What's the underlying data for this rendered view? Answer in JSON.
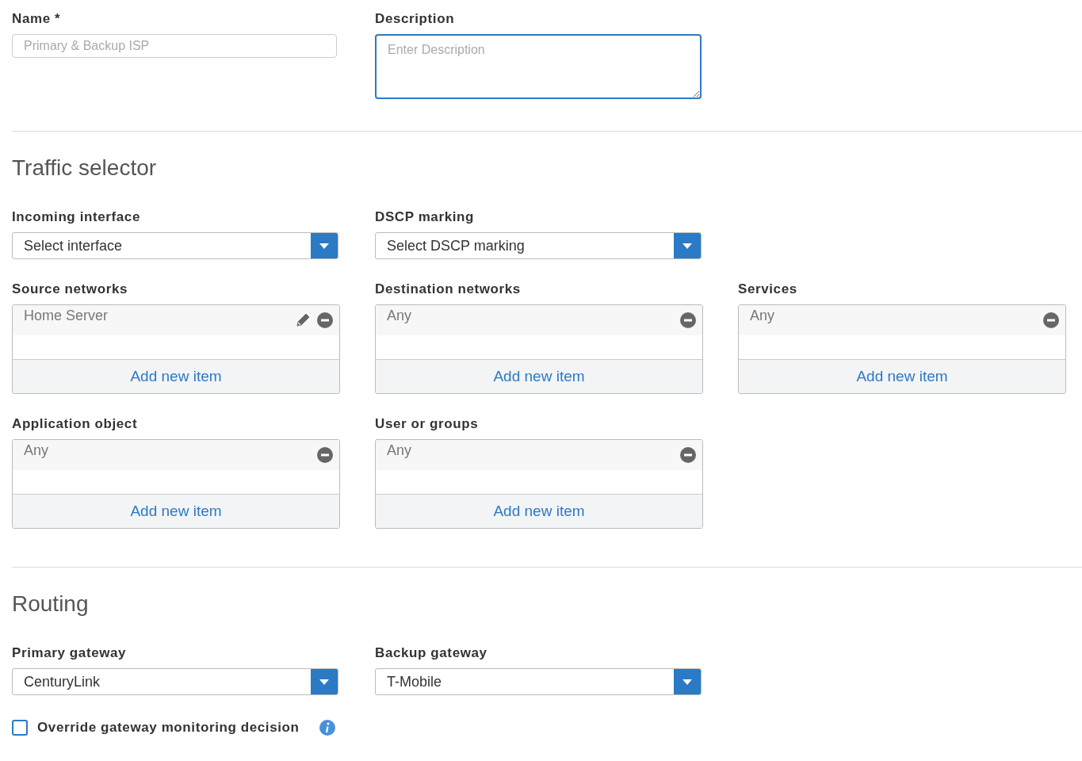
{
  "name_field": {
    "label": "Name *",
    "placeholder": "Primary & Backup ISP"
  },
  "description_field": {
    "label": "Description",
    "placeholder": "Enter Description",
    "focused": true
  },
  "traffic_selector": {
    "title": "Traffic selector",
    "dropdowns": [
      {
        "label": "Incoming interface",
        "value": "Select interface"
      },
      {
        "label": "DSCP marking",
        "value": "Select DSCP marking"
      }
    ],
    "lists": [
      {
        "label": "Source networks",
        "items": [
          {
            "text": "Home Server",
            "editable": true
          }
        ],
        "add_label": "Add new item"
      },
      {
        "label": "Destination networks",
        "items": [
          {
            "text": "Any",
            "editable": false
          }
        ],
        "add_label": "Add new item"
      },
      {
        "label": "Services",
        "items": [
          {
            "text": "Any",
            "editable": false
          }
        ],
        "add_label": "Add new item"
      },
      {
        "label": "Application object",
        "items": [
          {
            "text": "Any",
            "editable": false
          }
        ],
        "add_label": "Add new item"
      },
      {
        "label": "User or groups",
        "items": [
          {
            "text": "Any",
            "editable": false
          }
        ],
        "add_label": "Add new item"
      }
    ]
  },
  "routing": {
    "title": "Routing",
    "dropdowns": [
      {
        "label": "Primary gateway",
        "value": "CenturyLink"
      },
      {
        "label": "Backup gateway",
        "value": "T-Mobile"
      }
    ],
    "override": {
      "label": "Override gateway monitoring decision",
      "checked": false
    }
  }
}
